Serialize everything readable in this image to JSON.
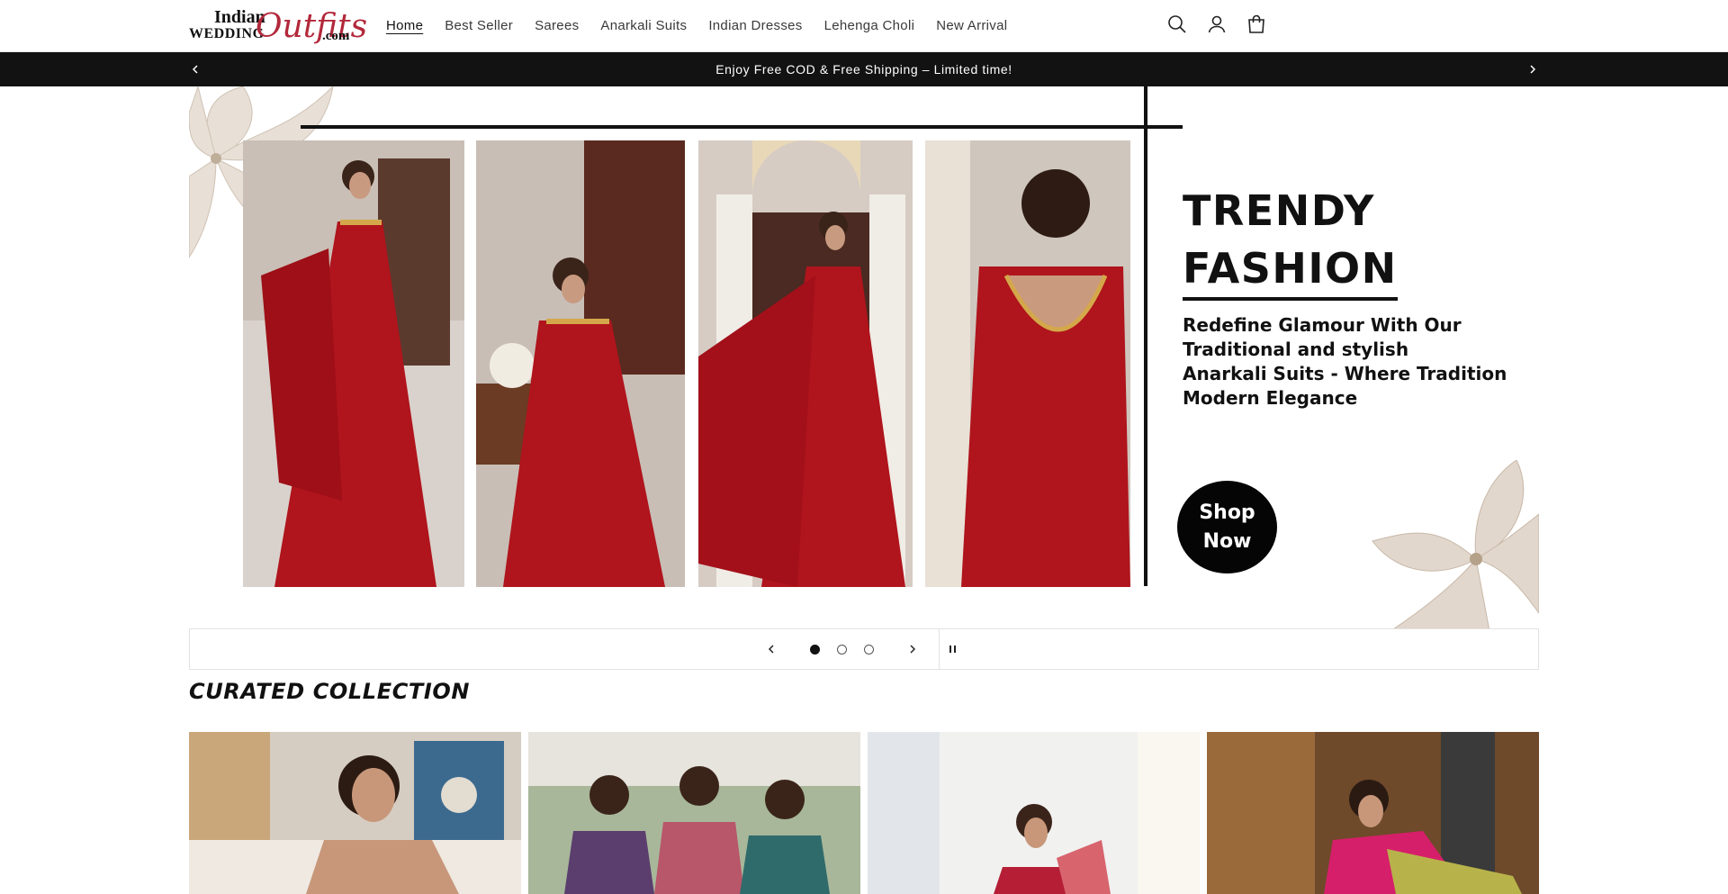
{
  "header": {
    "logo": {
      "line1": "Indian",
      "line2": "WEDDING",
      "script": "Outfits",
      "suffix": ".com"
    },
    "nav": [
      {
        "label": "Home",
        "active": true
      },
      {
        "label": "Best Seller"
      },
      {
        "label": "Sarees"
      },
      {
        "label": "Anarkali Suits"
      },
      {
        "label": "Indian Dresses"
      },
      {
        "label": "Lehenga Choli"
      },
      {
        "label": "New Arrival"
      }
    ],
    "icons": [
      "search-icon",
      "account-icon",
      "cart-icon"
    ]
  },
  "announcement": {
    "text": "Enjoy Free COD & Free Shipping – Limited time!",
    "icons": [
      "chevron-left-icon",
      "chevron-right-icon"
    ]
  },
  "hero": {
    "heading_line1": "TRENDY",
    "heading_line2": "FASHION",
    "tagline": [
      "Redefine Glamour With Our",
      "Traditional and stylish",
      "Anarkali Suits - Where Tradition",
      "Modern Elegance"
    ],
    "cta_line1": "Shop",
    "cta_line2": "Now"
  },
  "slider": {
    "slide_count": 3,
    "active_slide": 1,
    "icons": [
      "chevron-left-icon",
      "chevron-right-icon",
      "pause-icon"
    ]
  },
  "curated": {
    "title": "CURATED COLLECTION"
  },
  "colors": {
    "dark": "#121212",
    "dress_red": "#b0141c",
    "logo_accent": "#b2283a"
  }
}
